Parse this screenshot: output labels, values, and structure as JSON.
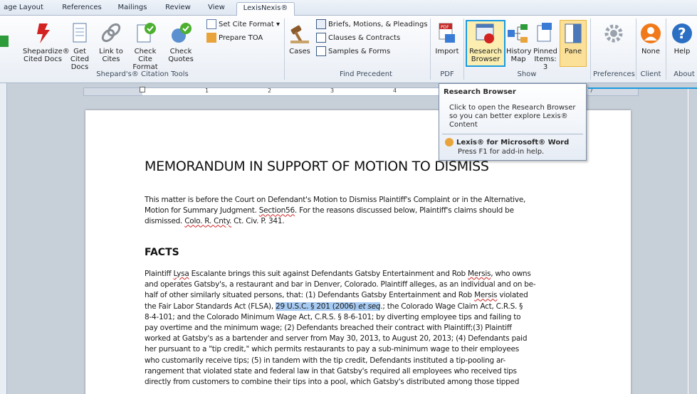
{
  "tabs": [
    "age Layout",
    "References",
    "Mailings",
    "Review",
    "View",
    "LexisNexis®"
  ],
  "ribbon": {
    "citation_group": "Shepard's® Citation Tools",
    "shepardize": [
      "Shepardize®",
      "Cited Docs"
    ],
    "get_cited": [
      "Get Cited",
      "Docs"
    ],
    "link_to": [
      "Link to",
      "Cites"
    ],
    "check_cite": [
      "Check Cite",
      "Format"
    ],
    "check_quotes": [
      "Check",
      "Quotes"
    ],
    "set_cite_format": "Set Cite Format",
    "prepare_toa": "Prepare TOA",
    "precedent_group": "Find Precedent",
    "cases": "Cases",
    "briefs": "Briefs, Motions, & Pleadings",
    "clauses": "Clauses & Contracts",
    "samples": "Samples & Forms",
    "pdf_group": "PDF",
    "import": "Import",
    "show_group": "Show",
    "research_browser": [
      "Research",
      "Browser"
    ],
    "history_map": [
      "History",
      "Map"
    ],
    "pinned_items": [
      "Pinned",
      "Items: 3"
    ],
    "pane": "Pane",
    "preferences_group": "Preferences",
    "client_group": "Client",
    "none": "None",
    "about_group": "About",
    "help": "Help",
    "colors": {
      "accent": "#1a9be0",
      "pane": "#fbe09a"
    }
  },
  "ruler": {
    "numbers": [
      "1",
      "2",
      "3",
      "4",
      "7"
    ]
  },
  "tooltip": {
    "title": "Research Browser",
    "description": "Click to open the Research Browser so you can better explore Lexis® Content",
    "brand": "Lexis® for Microsoft® Word",
    "help": "Press F1 for add-in help."
  },
  "document": {
    "title": "MEMORANDUM IN SUPPORT OF MOTION TO DISMISS",
    "intro": {
      "l1": "This matter is before the Court on Defendant's Motion to Dismiss Plaintiff's Complaint or in the Alternative,",
      "l2a": "Motion for Summary Judgment. ",
      "l2b": "Section56",
      "l2c": ". For the reasons discussed below, Plaintiff's claims should be",
      "l3a": "dismissed. ",
      "l3b": "Colo. R. Cnty.",
      "l3c": " Ct. Civ. P. 341."
    },
    "facts_heading": "FACTS",
    "facts": {
      "l1a": "Plaintiff ",
      "l1b": "Lysa",
      "l1c": " Escalante brings this suit against Defendants Gatsby Entertainment and Rob ",
      "l1d": "Mersis",
      "l1e": ", who owns",
      "l2": "and operates Gatsby's, a restaurant and bar in Denver, Colorado. Plaintiff alleges, as an individual and on be-",
      "l3a": "half of other similarly situated persons, that: (1) Defendants Gatsby Entertainment and Rob ",
      "l3b": "Mersis",
      "l3c": " violated",
      "l4a": "the Fair Labor Standards Act (FLSA), ",
      "l4b": "29 U.S.C. § 201 (2006) ",
      "l4c": "et seq",
      "l4d": ".; the Colorado Wage Claim Act, C.R.S. §",
      "l5": "8-4-101; and the Colorado Minimum Wage Act, C.R.S. § 8-6-101;  by diverting employee tips and failing to",
      "l6": "pay overtime and the minimum wage; (2) Defendants breached their contract with Plaintiff;(3) Plaintiff",
      "l7": "worked at Gatsby's as a bartender and server from May 30, 2013, to August 20, 2013; (4) Defendants paid",
      "l8": "her pursuant to a \"tip credit,\" which permits restaurants to pay a sub-minimum wage to their employees",
      "l9": "who customarily receive tips; (5) in tandem with the tip credit, Defendants instituted a tip-pooling ar-",
      "l10": "rangement that violated state and federal law in that Gatsby's required all employees who received tips",
      "l11": "directly from customers to combine their tips into a pool, which Gatsby's distributed among those tipped"
    }
  }
}
